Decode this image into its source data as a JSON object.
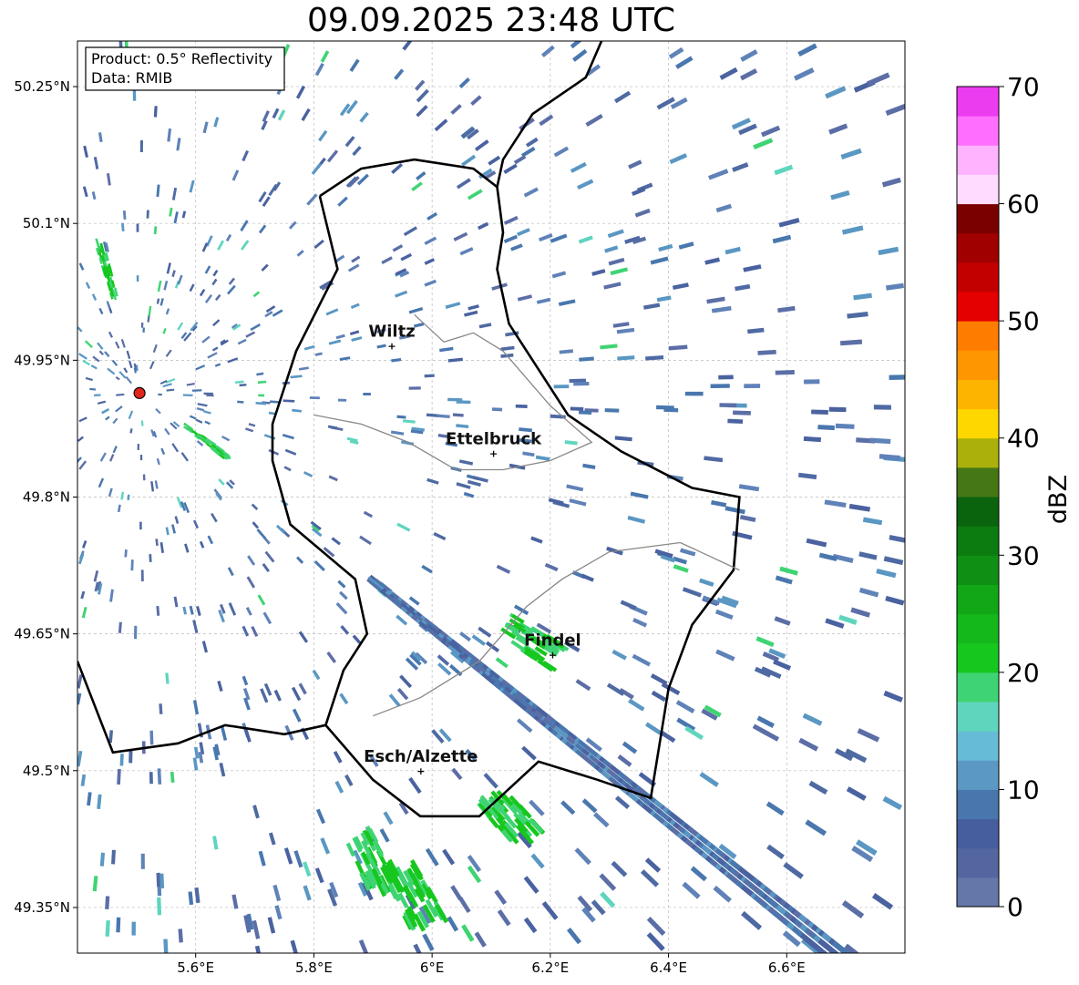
{
  "title": "09.09.2025 23:48 UTC",
  "info_box": {
    "product": "Product: 0.5° Reflectivity",
    "data": "Data: RMIB"
  },
  "map": {
    "lon_range": [
      5.4,
      6.8
    ],
    "lat_range": [
      49.3,
      50.3
    ],
    "lon_ticks": [
      {
        "value": 5.6,
        "label": "5.6°E"
      },
      {
        "value": 5.8,
        "label": "5.8°E"
      },
      {
        "value": 6.0,
        "label": "6°E"
      },
      {
        "value": 6.2,
        "label": "6.2°E"
      },
      {
        "value": 6.4,
        "label": "6.4°E"
      },
      {
        "value": 6.6,
        "label": "6.6°E"
      }
    ],
    "lat_ticks": [
      {
        "value": 50.25,
        "label": "50.25°N"
      },
      {
        "value": 50.1,
        "label": "50.1°N"
      },
      {
        "value": 49.95,
        "label": "49.95°N"
      },
      {
        "value": 49.8,
        "label": "49.8°N"
      },
      {
        "value": 49.65,
        "label": "49.65°N"
      },
      {
        "value": 49.5,
        "label": "49.5°N"
      },
      {
        "value": 49.35,
        "label": "49.35°N"
      }
    ],
    "radar": {
      "lon": 5.505,
      "lat": 49.914
    },
    "cities": [
      {
        "name": "Wiltz",
        "lon": 5.932,
        "lat": 49.966
      },
      {
        "name": "Ettelbruck",
        "lon": 6.104,
        "lat": 49.848
      },
      {
        "name": "Findel",
        "lon": 6.204,
        "lat": 49.627
      },
      {
        "name": "Esch/Alzette",
        "lon": 5.981,
        "lat": 49.5
      }
    ]
  },
  "colorbar": {
    "label": "dBZ",
    "min": 0,
    "max": 70,
    "ticks": [
      "0",
      "10",
      "20",
      "30",
      "40",
      "50",
      "60",
      "70"
    ],
    "colors": [
      "#6577a8",
      "#5466a0",
      "#465e9d",
      "#4876ad",
      "#5b98c4",
      "#66bcd6",
      "#5fd5be",
      "#3fd473",
      "#16c71e",
      "#14b81a",
      "#12a716",
      "#0f8f13",
      "#0c7b10",
      "#0a640d",
      "#457715",
      "#abb10a",
      "#fed600",
      "#fdb400",
      "#fd9600",
      "#fe7d00",
      "#e40000",
      "#c30000",
      "#a10000",
      "#7a0000",
      "#ffdcff",
      "#ffb3ff",
      "#ff6eff",
      "#ec3cf0"
    ]
  }
}
